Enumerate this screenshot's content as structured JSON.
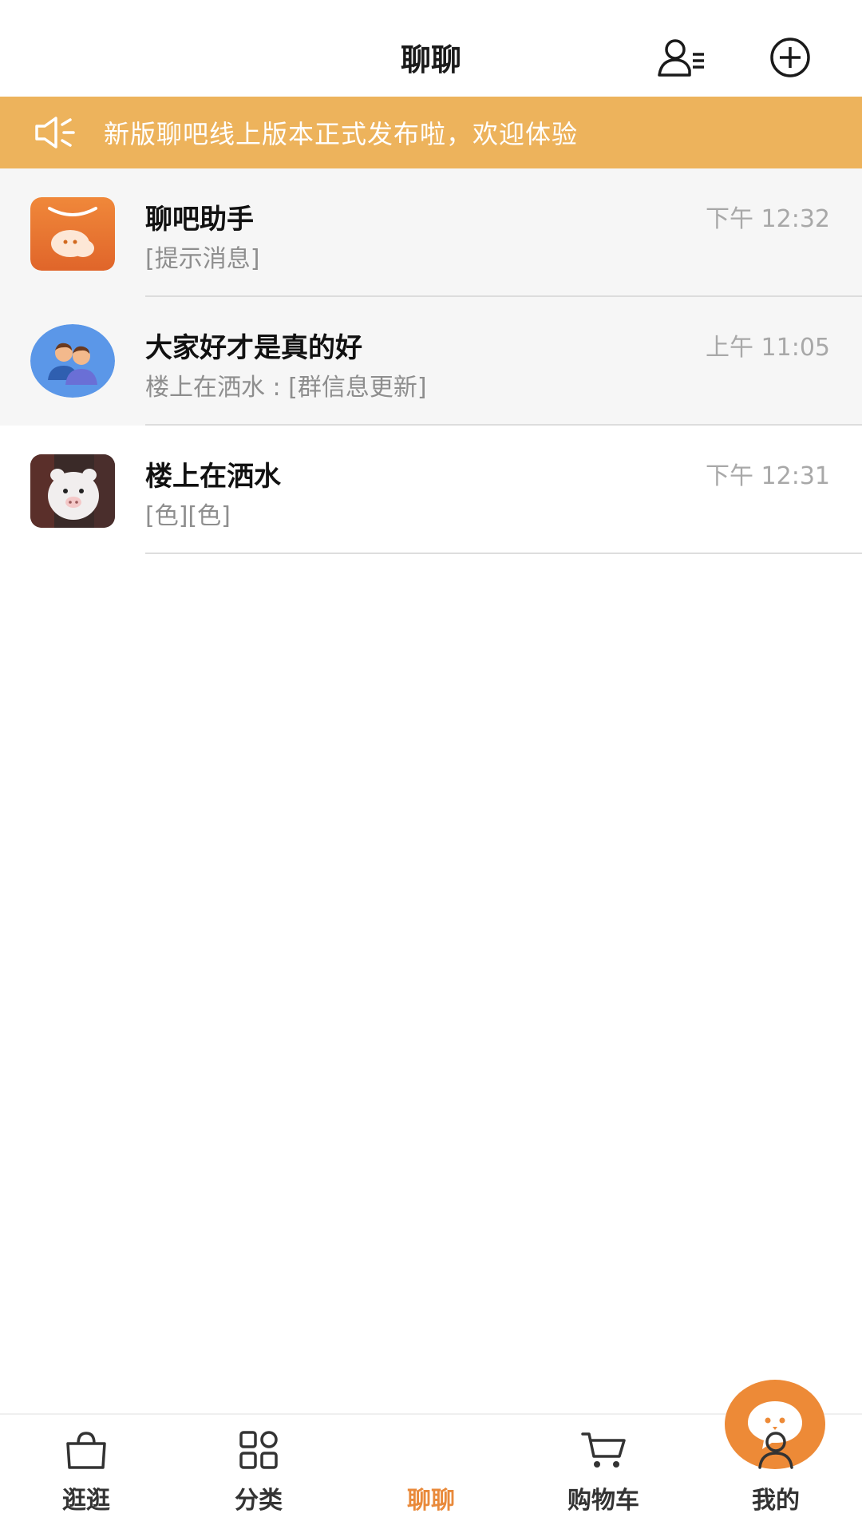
{
  "header": {
    "title": "聊聊",
    "contacts_icon": "contacts-list-icon",
    "add_icon": "plus-circle-icon"
  },
  "notice": {
    "icon": "speaker-icon",
    "text": "新版聊吧线上版本正式发布啦，欢迎体验"
  },
  "conversations": [
    {
      "name": "聊吧助手",
      "preview": "[提示消息]",
      "time": "下午 12:32",
      "avatar": "assistant-app-icon"
    },
    {
      "name": "大家好才是真的好",
      "preview": "楼上在洒水 : [群信息更新]",
      "time": "上午 11:05",
      "avatar": "group-avatar-icon"
    },
    {
      "name": "楼上在洒水",
      "preview": "[色][色]",
      "time": "下午 12:31",
      "avatar": "user-photo-avatar"
    }
  ],
  "tabbar": {
    "tabs": [
      {
        "label": "逛逛",
        "icon": "shopping-bag-icon"
      },
      {
        "label": "分类",
        "icon": "grid-icon"
      },
      {
        "label": "聊聊",
        "icon": "chat-bubble-icon",
        "active": true
      },
      {
        "label": "购物车",
        "icon": "cart-icon"
      },
      {
        "label": "我的",
        "icon": "person-icon"
      }
    ]
  },
  "colors": {
    "accent": "#ed8a37",
    "notice_bg": "#edb35c",
    "active_tab_text": "#e98a3b",
    "row_shaded_bg": "#f6f6f6"
  }
}
